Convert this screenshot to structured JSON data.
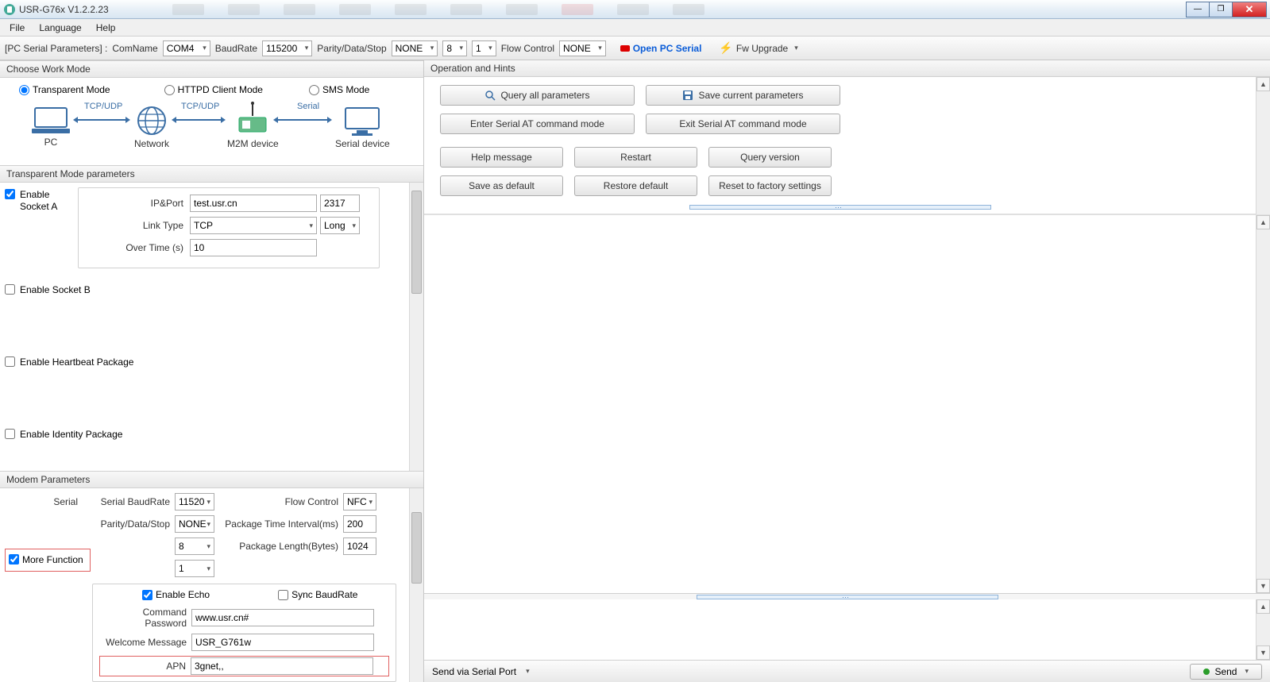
{
  "window": {
    "title": "USR-G76x V1.2.2.23"
  },
  "menu": {
    "file": "File",
    "language": "Language",
    "help": "Help"
  },
  "toolbar": {
    "pc_serial_label": "[PC Serial Parameters] :",
    "comname_label": "ComName",
    "comname_value": "COM4",
    "baudrate_label": "BaudRate",
    "baudrate_value": "115200",
    "pds_label": "Parity/Data/Stop",
    "pds_parity": "NONE",
    "pds_data": "8",
    "pds_stop": "1",
    "flowctl_label": "Flow Control",
    "flowctl_value": "NONE",
    "open_serial": "Open PC Serial",
    "fw_upgrade": "Fw Upgrade"
  },
  "workmode": {
    "header": "Choose Work Mode",
    "transparent": "Transparent Mode",
    "httpd": "HTTPD Client Mode",
    "sms": "SMS Mode",
    "diag": {
      "tcpudp": "TCP/UDP",
      "serial": "Serial",
      "pc": "PC",
      "network": "Network",
      "m2m": "M2M device",
      "serialdev": "Serial device"
    }
  },
  "trans": {
    "header": "Transparent Mode parameters",
    "enable_a": "Enable Socket A",
    "ipport_label": "IP&Port",
    "ip_value": "test.usr.cn",
    "port_value": "2317",
    "linktype_label": "Link Type",
    "linktype_value": "TCP",
    "conn_value": "Long",
    "overtime_label": "Over Time (s)",
    "overtime_value": "10",
    "enable_b": "Enable Socket B",
    "enable_hb": "Enable Heartbeat Package",
    "enable_id": "Enable Identity Package"
  },
  "modem": {
    "header": "Modem Parameters",
    "serial_lbl": "Serial",
    "baudrate_lbl": "Serial BaudRate",
    "baudrate_val": "11520",
    "flowctl_lbl": "Flow Control",
    "flowctl_val": "NFC",
    "pds_lbl": "Parity/Data/Stop",
    "pds_parity": "NONE",
    "pds_data": "8",
    "pds_stop": "1",
    "pti_lbl": "Package Time Interval(ms)",
    "pti_val": "200",
    "plb_lbl": "Package Length(Bytes)",
    "plb_val": "1024",
    "morefn": "More Function",
    "echo": "Enable Echo",
    "sync": "Sync BaudRate",
    "cmdpw_lbl": "Command Password",
    "cmdpw_val": "www.usr.cn#",
    "welcome_lbl": "Welcome Message",
    "welcome_val": "USR_G761w",
    "apn_lbl": "APN",
    "apn_val": "3gnet,,"
  },
  "ops": {
    "header": "Operation and Hints",
    "query_all": "Query all parameters",
    "save_current": "Save current parameters",
    "enter_at": "Enter Serial AT command mode",
    "exit_at": "Exit Serial AT command mode",
    "help": "Help message",
    "restart": "Restart",
    "query_ver": "Query version",
    "save_def": "Save as default",
    "restore_def": "Restore default",
    "factory": "Reset to factory settings"
  },
  "bottom": {
    "send_via": "Send via Serial Port",
    "send": "Send"
  }
}
